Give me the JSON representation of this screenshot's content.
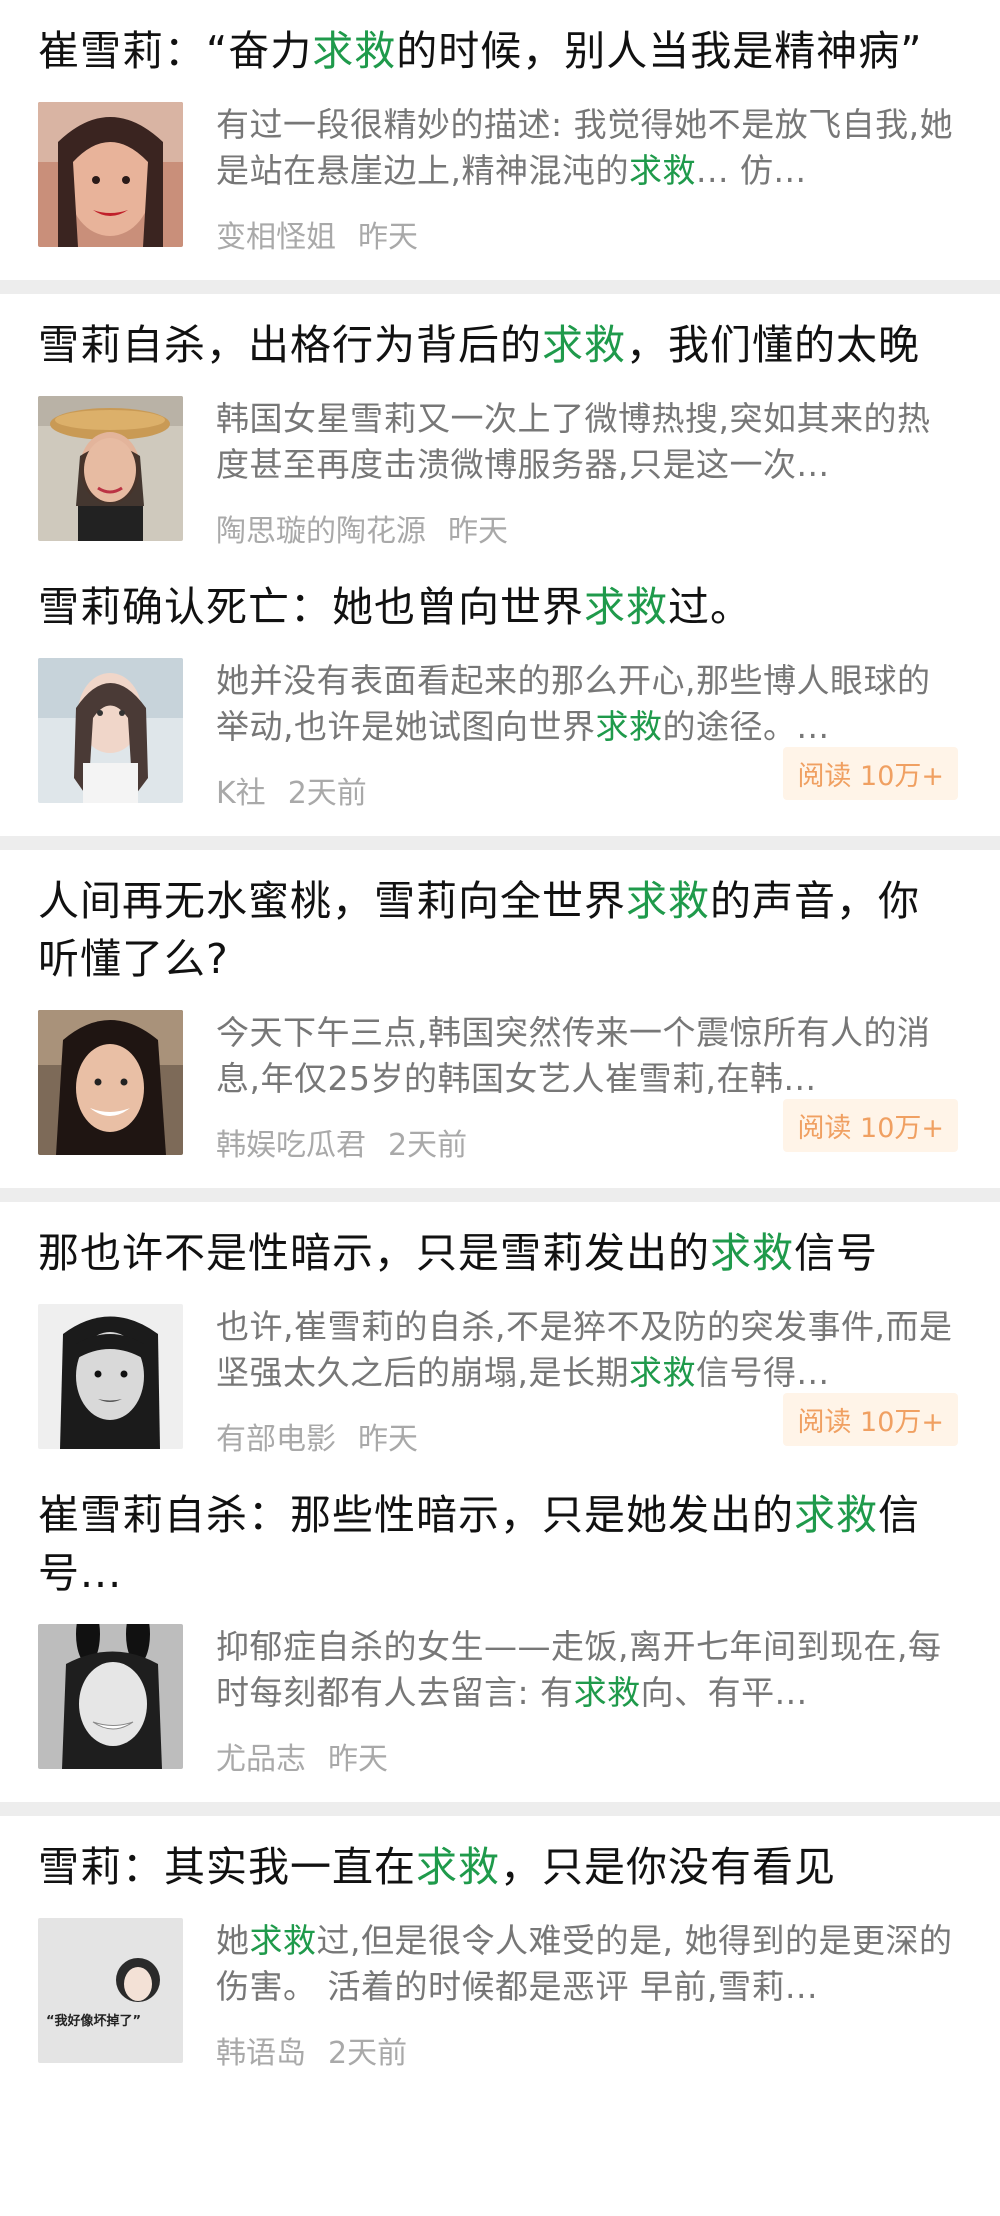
{
  "articles": [
    {
      "title": [
        {
          "t": "崔雪莉：“奋力"
        },
        {
          "t": "求救",
          "hl": true
        },
        {
          "t": "的时候，别人当我是精神病”"
        }
      ],
      "excerpt": [
        {
          "t": "有过一段很精妙的描述: 我觉得她不是放飞自我,她是站在悬崖边上,精神混沌的"
        },
        {
          "t": "求救",
          "hl": true
        },
        {
          "t": "... 仿..."
        }
      ],
      "source": "变相怪姐",
      "time": "昨天",
      "badge": "",
      "thumb": "photo-smiling-woman-red-lips"
    },
    {
      "title": [
        {
          "t": "雪莉自杀，出格行为背后的"
        },
        {
          "t": "求救",
          "hl": true
        },
        {
          "t": "，我们懂的太晚"
        }
      ],
      "excerpt": [
        {
          "t": "韩国女星雪莉又一次上了微博热搜,突如其来的热度甚至再度击溃微博服务器,只是这一次..."
        }
      ],
      "source": "陶思璇的陶花源",
      "time": "昨天",
      "badge": "",
      "thumb": "photo-woman-with-bread-on-head"
    },
    {
      "title": [
        {
          "t": "雪莉确认死亡：她也曾向世界"
        },
        {
          "t": "求救",
          "hl": true
        },
        {
          "t": "过。"
        }
      ],
      "excerpt": [
        {
          "t": "她并没有表面看起来的那么开心,那些博人眼球的举动,也许是她试图向世界"
        },
        {
          "t": "求救",
          "hl": true
        },
        {
          "t": "的途径。..."
        }
      ],
      "source": "K社",
      "time": "2天前",
      "badge": "阅读 10万+",
      "thumb": "photo-woman-braids-looking-up"
    },
    {
      "title": [
        {
          "t": "人间再无水蜜桃，雪莉向全世界"
        },
        {
          "t": "求救",
          "hl": true
        },
        {
          "t": "的声音，你听懂了么?"
        }
      ],
      "excerpt": [
        {
          "t": "今天下午三点,韩国突然传来一个震惊所有人的消息,年仅25岁的韩国女艺人崔雪莉,在韩..."
        }
      ],
      "source": "韩娱吃瓜君",
      "time": "2天前",
      "badge": "阅读 10万+",
      "thumb": "photo-woman-smiling-beach"
    },
    {
      "title": [
        {
          "t": "那也许不是性暗示，只是雪莉发出的"
        },
        {
          "t": "求救",
          "hl": true
        },
        {
          "t": "信号"
        }
      ],
      "excerpt": [
        {
          "t": "也许,崔雪莉的自杀,不是猝不及防的突发事件,而是坚强太久之后的崩塌,是长期"
        },
        {
          "t": "求救",
          "hl": true
        },
        {
          "t": "信号得..."
        }
      ],
      "source": "有部电影",
      "time": "昨天",
      "badge": "阅读 10万+",
      "thumb": "photo-woman-black-and-white"
    },
    {
      "title": [
        {
          "t": "崔雪莉自杀：那些性暗示，只是她发出的"
        },
        {
          "t": "求救",
          "hl": true
        },
        {
          "t": "信号..."
        }
      ],
      "excerpt": [
        {
          "t": "抑郁症自杀的女生——走饭,离开七年间到现在,每时每刻都有人去留言: 有"
        },
        {
          "t": "求救",
          "hl": true
        },
        {
          "t": "向、有平..."
        }
      ],
      "source": "尤品志",
      "time": "昨天",
      "badge": "",
      "thumb": "photo-woman-bunny-ears-bw"
    },
    {
      "title": [
        {
          "t": "雪莉：其实我一直在"
        },
        {
          "t": "求救",
          "hl": true
        },
        {
          "t": "，只是你没有看见"
        }
      ],
      "excerpt": [
        {
          "t": "她"
        },
        {
          "t": "求救",
          "hl": true
        },
        {
          "t": "过,但是很令人难受的是, 她得到的是更深的伤害。 活着的时候都是恶评 早前,雪莉..."
        }
      ],
      "source": "韩语岛",
      "time": "2天前",
      "badge": "",
      "thumb": "photo-quote-graphic",
      "thumb_caption": "“我好像坏掉了”"
    }
  ],
  "colors": {
    "highlight": "#1f9a4b",
    "badge_bg": "#fff4e8",
    "badge_text": "#f0a062",
    "divider": "#ededed"
  }
}
